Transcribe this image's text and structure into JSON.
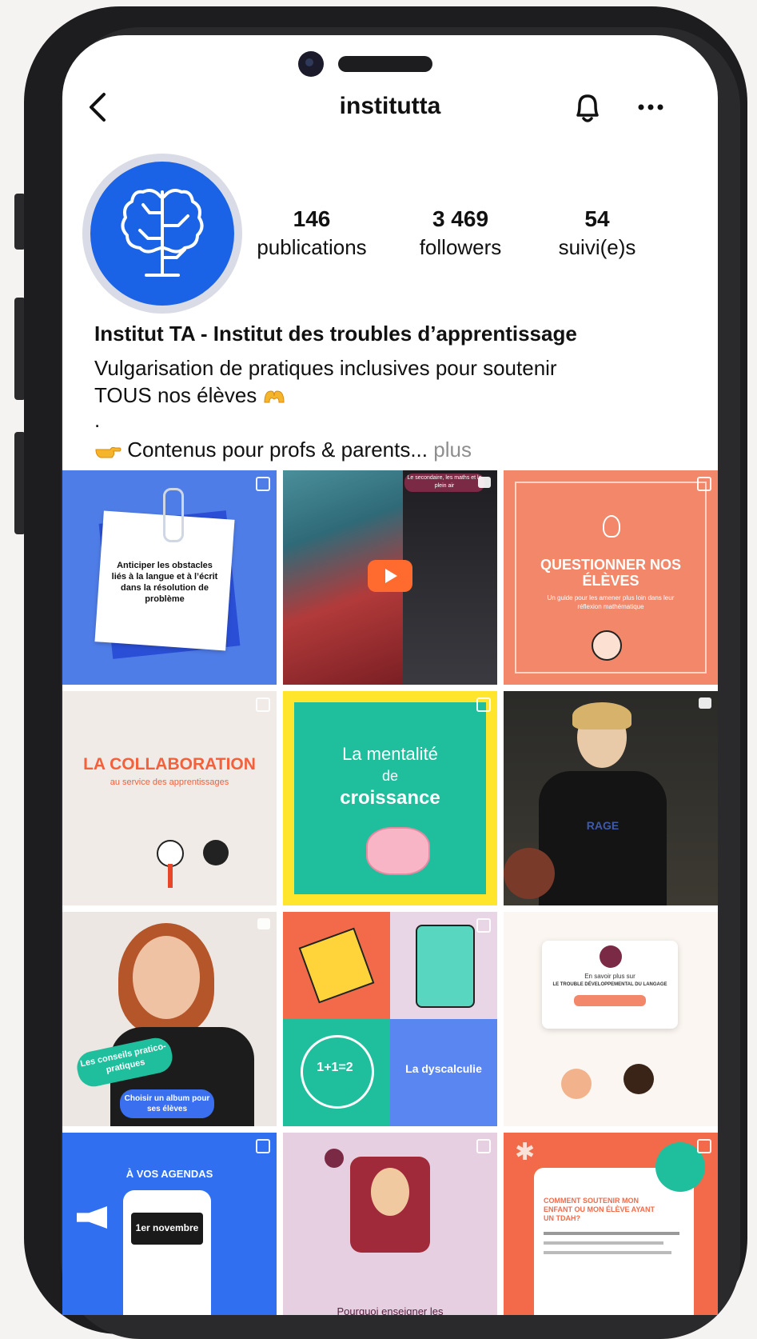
{
  "profile": {
    "handle": "institutta",
    "stats": {
      "publications": {
        "value": "146",
        "label": "publications"
      },
      "followers": {
        "value": "3 469",
        "label": "followers"
      },
      "following": {
        "value": "54",
        "label": "suivi(e)s"
      }
    },
    "display_name": "Institut TA - Institut des troubles d’apprentissage",
    "bio_line1": "Vulgarisation de pratiques inclusives pour soutenir",
    "bio_line2": "TOUS nos élèves",
    "bio_dot": ".",
    "bio_line3": "Contenus pour profs & parents...",
    "more_link": "plus"
  },
  "icons": [
    "back-arrow-icon",
    "bell-icon",
    "more-options-icon",
    "brain-logo-icon",
    "heart-hands-emoji",
    "pointing-hand-emoji",
    "carousel-icon",
    "reel-icon",
    "play-icon"
  ],
  "colors": {
    "brand_blue": "#1a63e6",
    "coral": "#f3876a",
    "teal": "#1fbf9e",
    "yellow": "#ffe52b",
    "plum": "#7a2a44"
  },
  "posts": [
    {
      "text": "Anticiper les obstacles liés à la langue et à l’écrit dans la résolution de problème"
    },
    {
      "text": "Le secondaire, les maths et le plein air"
    },
    {
      "title": "QUESTIONNER NOS ÉLÈVES",
      "subtitle": "Un guide pour les amener plus loin dans leur réflexion mathématique"
    },
    {
      "title": "LA COLLABORATION",
      "subtitle": "au service des apprentissages"
    },
    {
      "line1": "La mentalité",
      "line2": "de",
      "line3": "croissance"
    },
    {
      "text": "RAGE"
    },
    {
      "badge1": "Les conseils pratico-pratiques",
      "badge2": "Choisir un album pour ses élèves"
    },
    {
      "title": "La dyscalculie",
      "eq": "1+1=2"
    },
    {
      "line1": "En savoir plus sur",
      "line2": "LE TROUBLE DÉVELOPPEMENTAL DU LANGAGE"
    },
    {
      "title": "À VOS AGENDAS",
      "date": "1er novembre"
    },
    {
      "text": "Pourquoi enseigner les"
    },
    {
      "title": "COMMENT SOUTENIR MON ENFANT OU MON ÉLÈVE AYANT UN TDAH?"
    }
  ]
}
